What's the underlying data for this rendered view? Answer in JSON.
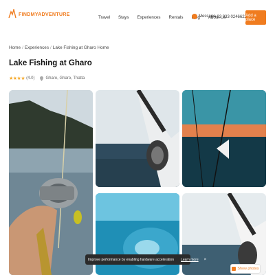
{
  "header": {
    "logo_text": "FINDMYADVENTURE",
    "nav": [
      "Travel",
      "Stays",
      "Experiences",
      "Rentals",
      "Blog",
      "About Us"
    ],
    "whatsapp_label": "Message",
    "phone": "+92 333 0246622",
    "cta_label": "Add a place",
    "brand_color": "#f07c1f"
  },
  "breadcrumb": {
    "home": "Home",
    "section": "Experiences",
    "current": "Lake Fishing at Gharo Home"
  },
  "listing": {
    "title": "Lake Fishing at Gharo",
    "stars": "★★★★",
    "rating": "(4.0)",
    "location": "Gharo, Gharo, Thatta"
  },
  "gallery": {
    "icons": [
      "fishing-photo"
    ],
    "show_photos_label": "Show photos"
  },
  "toast": {
    "message": "Improve performance by enabling hardware acceleration",
    "link_label": "Learn more",
    "close_label": "×"
  }
}
